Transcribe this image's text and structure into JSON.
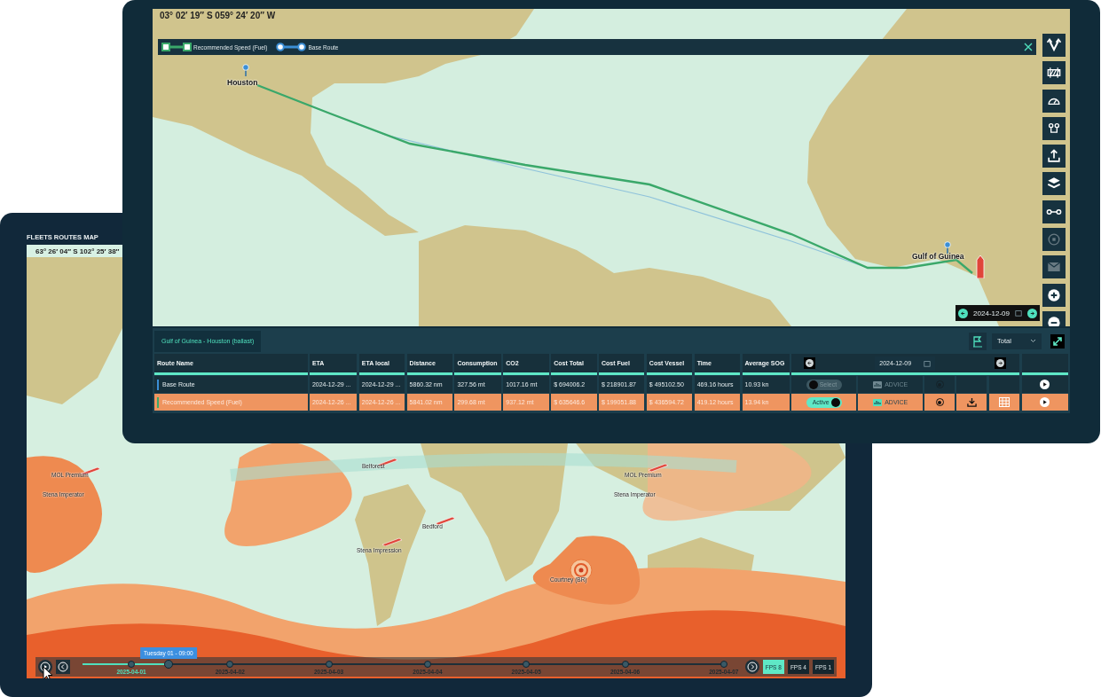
{
  "fleet_window": {
    "title": "FLEETS ROUTES MAP",
    "coordinates": "63° 26′ 04″ S 102° 25′ 38″",
    "vessels": [
      {
        "name": "MOL Premium",
        "kind": "vessel"
      },
      {
        "name": "Stena Imperator",
        "kind": "vessel"
      },
      {
        "name": "Belforest",
        "kind": "vessel"
      },
      {
        "name": "Bedford",
        "kind": "vessel"
      },
      {
        "name": "Stena Impression",
        "kind": "vessel"
      },
      {
        "name": "Courtney (BR)",
        "kind": "storm"
      },
      {
        "name": "MOL Premium",
        "kind": "vessel"
      },
      {
        "name": "Stena Imperator",
        "kind": "vessel"
      }
    ],
    "timeline": {
      "tooltip": "Tuesday 01 - 09:00",
      "level": 0.134,
      "dates": [
        {
          "label": "2025-04-01",
          "selected": true
        },
        {
          "label": "2025-04-02",
          "selected": false
        },
        {
          "label": "2025-04-03",
          "selected": false
        },
        {
          "label": "2025-04-04",
          "selected": false
        },
        {
          "label": "2025-04-05",
          "selected": false
        },
        {
          "label": "2025-04-06",
          "selected": false
        },
        {
          "label": "2025-04-07",
          "selected": false
        }
      ],
      "fps": [
        {
          "label": "FPS 8",
          "selected": true
        },
        {
          "label": "FPS 4",
          "selected": false
        },
        {
          "label": "FPS 1",
          "selected": false
        }
      ]
    }
  },
  "route_window": {
    "coordinates": "03° 02′ 19″ S 059° 24′ 20″ W",
    "legend": [
      {
        "label": "Recommended Speed (Fuel)",
        "kind": "square",
        "color": "#3aa86a"
      },
      {
        "label": "Base Route",
        "kind": "circle",
        "color": "#3b8fd6"
      }
    ],
    "ports": [
      {
        "name": "Houston"
      },
      {
        "name": "Gulf of Guinea"
      }
    ],
    "toolbar": [
      {
        "kind": "routes",
        "disabled": false
      },
      {
        "kind": "barrier",
        "disabled": false
      },
      {
        "kind": "gauge",
        "disabled": false
      },
      {
        "kind": "waypoints",
        "disabled": false
      },
      {
        "kind": "upload",
        "disabled": false
      },
      {
        "kind": "layers",
        "disabled": false
      },
      {
        "kind": "connector",
        "disabled": false
      },
      {
        "kind": "target",
        "disabled": true
      },
      {
        "kind": "mail",
        "disabled": true
      },
      {
        "kind": "zoom_in",
        "disabled": false
      },
      {
        "kind": "zoom_out",
        "disabled": false
      }
    ],
    "map_date": "2024-12-09",
    "tab": {
      "label": "Gulf of Guinea - Houston (ballast)",
      "selected": true
    },
    "aggregate": "Total",
    "table": {
      "columns": [
        "Route Name",
        "ETA",
        "ETA local",
        "Distance",
        "Consumption",
        "CO2",
        "Cost Total",
        "Cost Fuel",
        "Cost Vessel",
        "Time",
        "Average SOG"
      ],
      "date": "2024-12-09",
      "rows": [
        {
          "color": "#3b8fd6",
          "selected": false,
          "cells": [
            "Base Route",
            "2024-12-29 ...",
            "2024-12-29 ...",
            "5860.32 nm",
            "327.56 mt",
            "1017.16 mt",
            "$ 694006.2",
            "$ 218901.87",
            "$ 495102.50",
            "469.16 hours",
            "10.93 kn"
          ],
          "toggle": {
            "label": "Select",
            "on": false
          },
          "advice": {
            "label": "ADVICE",
            "disabled": true
          },
          "actions": false
        },
        {
          "color": "#3aa86a",
          "selected": true,
          "cells": [
            "Recommended Speed (Fuel)",
            "2024-12-26 ...",
            "2024-12-26 ...",
            "5841.02 nm",
            "299.68 mt",
            "937.12 mt",
            "$ 635646.6",
            "$ 199051.88",
            "$ 436594.72",
            "419.12 hours",
            "13.94 kn"
          ],
          "toggle": {
            "label": "Active",
            "on": true
          },
          "advice": {
            "label": "ADVICE",
            "disabled": false
          },
          "actions": true
        }
      ]
    }
  }
}
